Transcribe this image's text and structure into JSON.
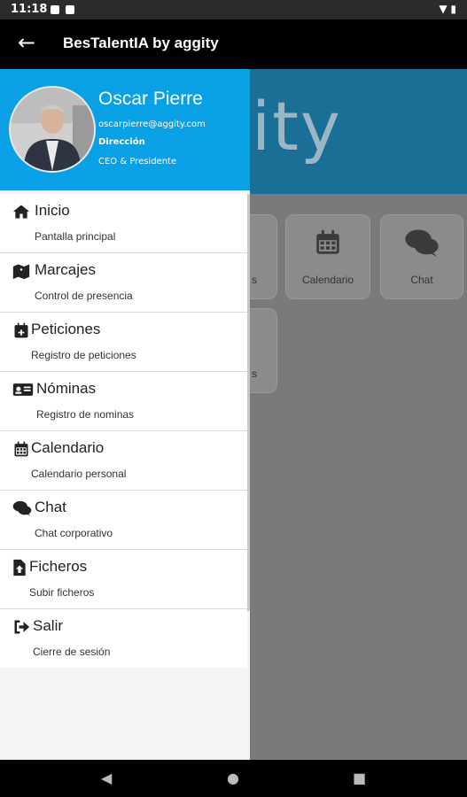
{
  "status": {
    "time": "11:18"
  },
  "appbar": {
    "title": "BesTalentIA by aggity"
  },
  "background": {
    "logo_text": "ity",
    "tiles": [
      {
        "label": "s"
      },
      {
        "label": "Calendario"
      },
      {
        "label": "Chat"
      },
      {
        "label": "s"
      }
    ]
  },
  "profile": {
    "name": "Oscar Pierre",
    "email": "oscarpierre@aggity.com",
    "department": "Dirección",
    "role": "CEO & Presidente"
  },
  "menu": [
    {
      "label": "Inicio",
      "sub": "Pantalla principal",
      "icon": "home-icon"
    },
    {
      "label": "Marcajes",
      "sub": "Control de presencia",
      "icon": "map-marker-icon"
    },
    {
      "label": "Peticiones",
      "sub": "Registro de peticiones",
      "icon": "calendar-plus-icon"
    },
    {
      "label": "Nóminas",
      "sub": "Registro de nominas",
      "icon": "id-card-icon"
    },
    {
      "label": "Calendario",
      "sub": "Calendario personal",
      "icon": "calendar-icon"
    },
    {
      "label": "Chat",
      "sub": "Chat corporativo",
      "icon": "chat-icon"
    },
    {
      "label": "Ficheros",
      "sub": "Subir ficheros",
      "icon": "file-upload-icon"
    },
    {
      "label": "Salir",
      "sub": "Cierre de sesión",
      "icon": "sign-out-icon"
    }
  ]
}
